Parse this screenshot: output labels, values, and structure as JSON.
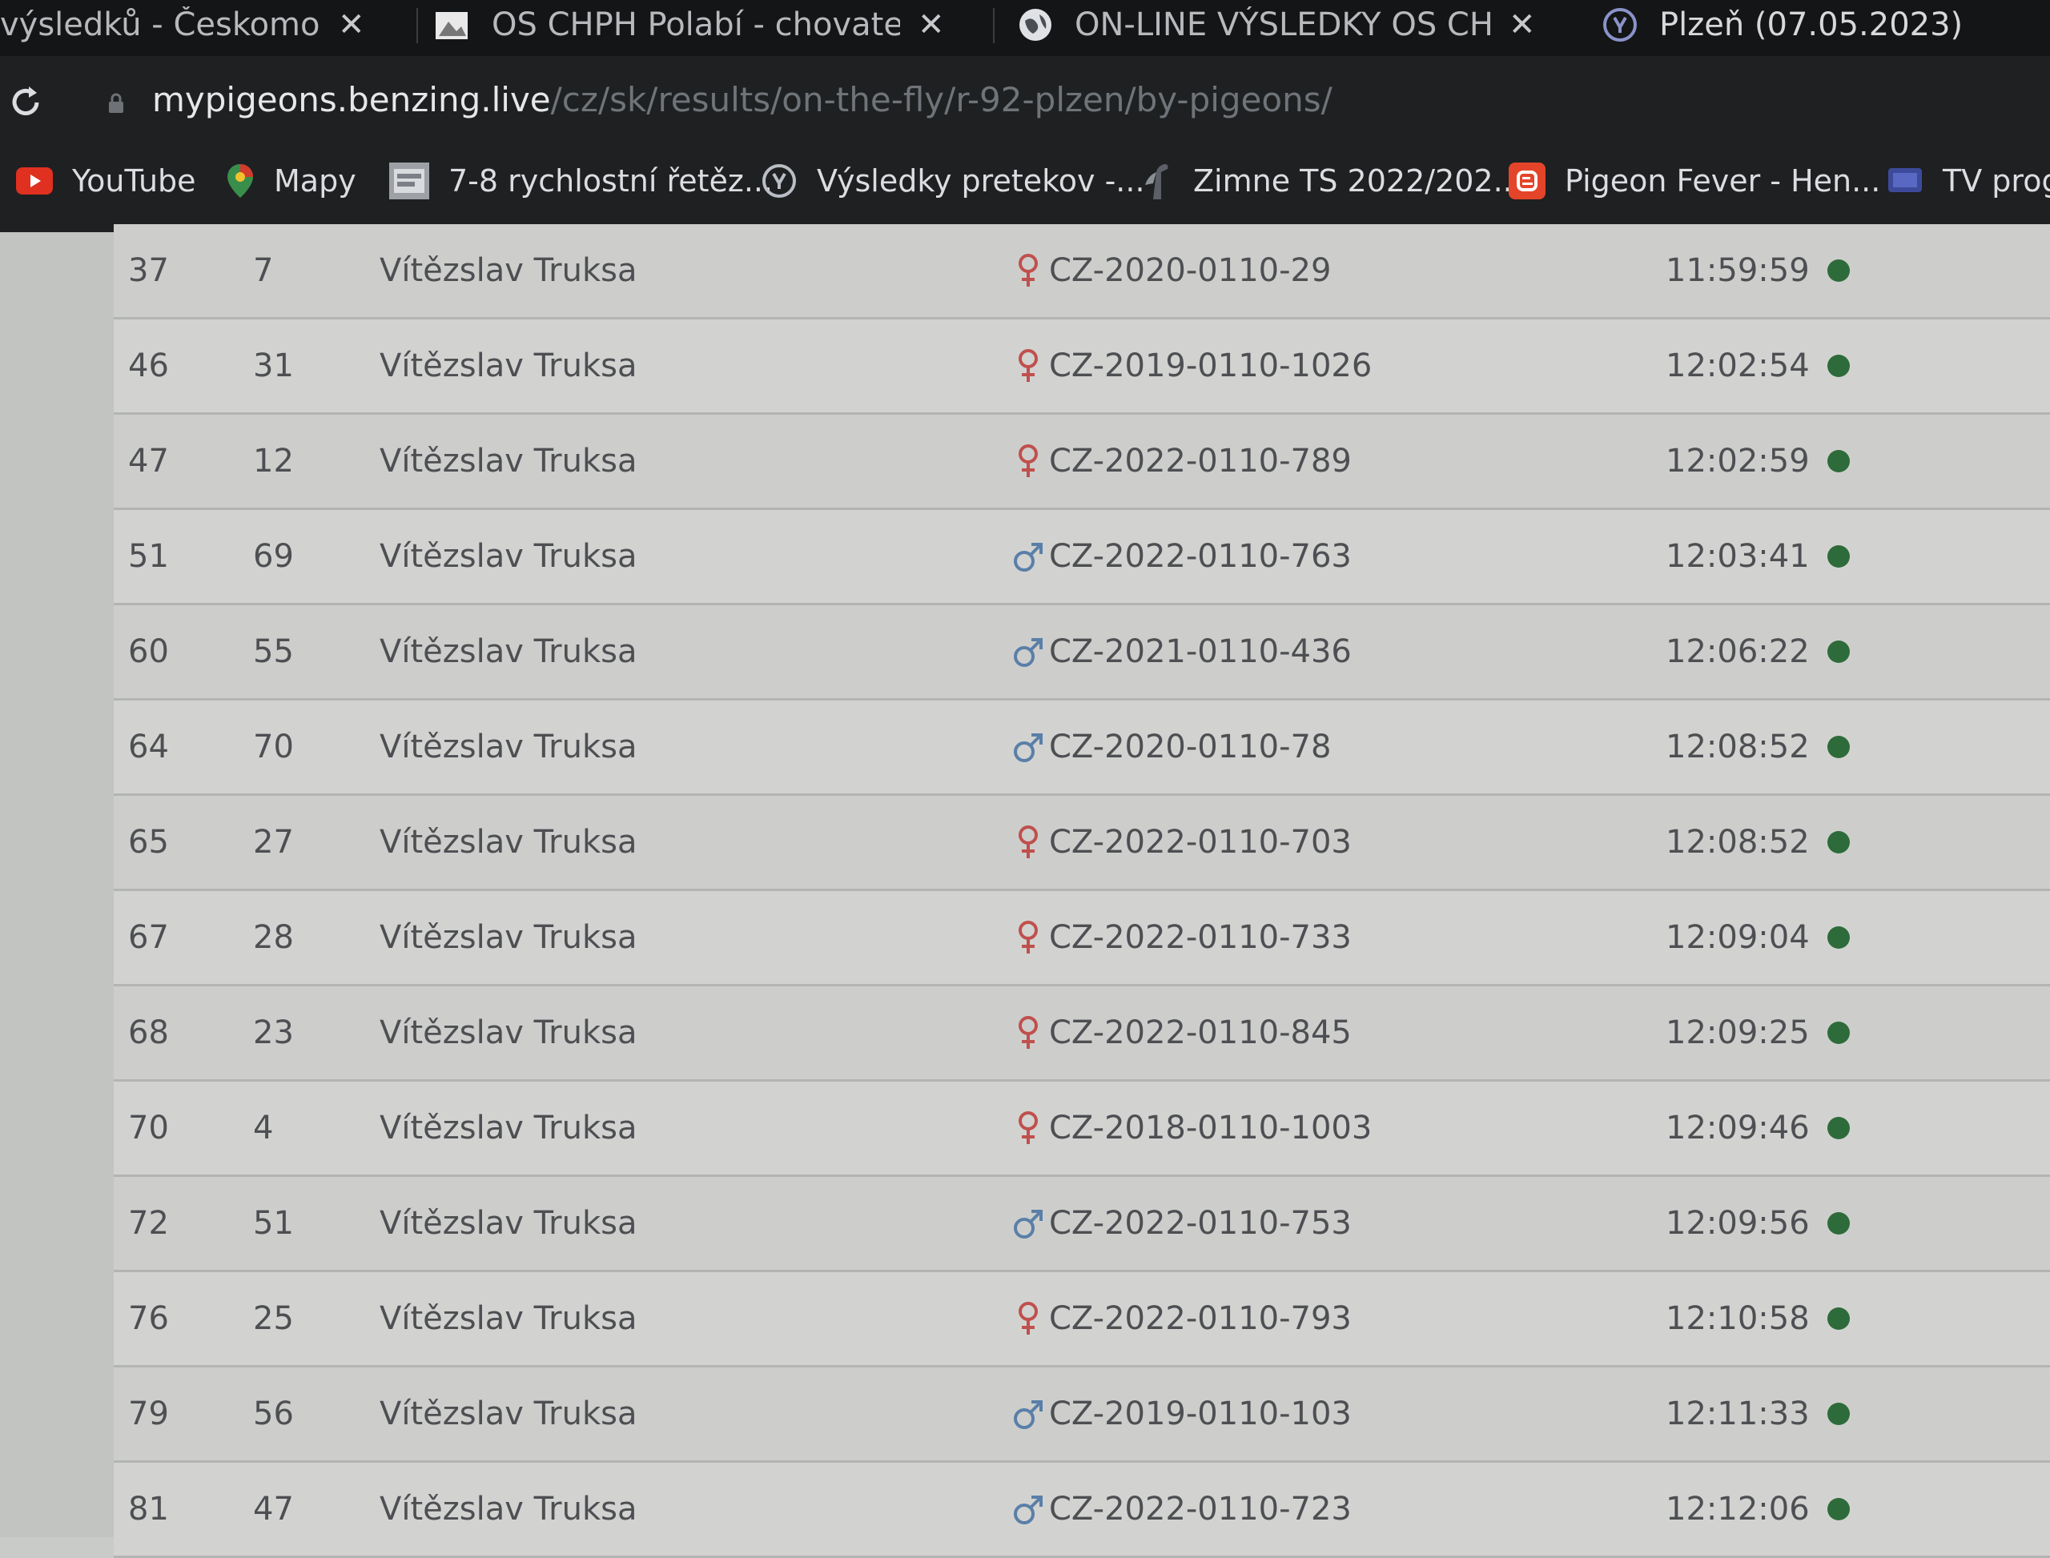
{
  "tabs": [
    {
      "title": "výsledků - Českomoravsk",
      "has_close": true
    },
    {
      "title": "OS CHPH Polabí - chovatelé po",
      "has_close": true,
      "favicon": "site-icon"
    },
    {
      "title": "ON-LINE VÝSLEDKY OS CHPH P",
      "has_close": true,
      "favicon": "globe-icon"
    },
    {
      "title": "Plzeň (07.05.2023)",
      "has_close": false,
      "favicon": "benzing-icon"
    }
  ],
  "address": {
    "host": "mypigeons.benzing.live",
    "path": "/cz/sk/results/on-the-fly/r-92-plzen/by-pigeons/"
  },
  "bookmarks": [
    {
      "label": "YouTube",
      "icon": "youtube-icon"
    },
    {
      "label": "Mapy",
      "icon": "map-pin-icon"
    },
    {
      "label": "7-8 rychlostní řetěz...",
      "icon": "image-icon"
    },
    {
      "label": "Výsledky pretekov -...",
      "icon": "benzing-icon"
    },
    {
      "label": "Zimne TS 2022/202...",
      "icon": "pigeon-icon"
    },
    {
      "label": "Pigeon Fever - Hen...",
      "icon": "blogger-icon"
    },
    {
      "label": "TV prog",
      "icon": "tv-icon"
    }
  ],
  "colors": {
    "female": "#c0504d",
    "male": "#5a7fa8",
    "status": "#2e6b3a"
  },
  "results": [
    {
      "rank": "37",
      "no": "7",
      "name": "Vítězslav Truksa",
      "sex": "female",
      "ring": "CZ-2020-0110-29",
      "time": "11:59:59"
    },
    {
      "rank": "46",
      "no": "31",
      "name": "Vítězslav Truksa",
      "sex": "female",
      "ring": "CZ-2019-0110-1026",
      "time": "12:02:54"
    },
    {
      "rank": "47",
      "no": "12",
      "name": "Vítězslav Truksa",
      "sex": "female",
      "ring": "CZ-2022-0110-789",
      "time": "12:02:59"
    },
    {
      "rank": "51",
      "no": "69",
      "name": "Vítězslav Truksa",
      "sex": "male",
      "ring": "CZ-2022-0110-763",
      "time": "12:03:41"
    },
    {
      "rank": "60",
      "no": "55",
      "name": "Vítězslav Truksa",
      "sex": "male",
      "ring": "CZ-2021-0110-436",
      "time": "12:06:22"
    },
    {
      "rank": "64",
      "no": "70",
      "name": "Vítězslav Truksa",
      "sex": "male",
      "ring": "CZ-2020-0110-78",
      "time": "12:08:52"
    },
    {
      "rank": "65",
      "no": "27",
      "name": "Vítězslav Truksa",
      "sex": "female",
      "ring": "CZ-2022-0110-703",
      "time": "12:08:52"
    },
    {
      "rank": "67",
      "no": "28",
      "name": "Vítězslav Truksa",
      "sex": "female",
      "ring": "CZ-2022-0110-733",
      "time": "12:09:04"
    },
    {
      "rank": "68",
      "no": "23",
      "name": "Vítězslav Truksa",
      "sex": "female",
      "ring": "CZ-2022-0110-845",
      "time": "12:09:25"
    },
    {
      "rank": "70",
      "no": "4",
      "name": "Vítězslav Truksa",
      "sex": "female",
      "ring": "CZ-2018-0110-1003",
      "time": "12:09:46"
    },
    {
      "rank": "72",
      "no": "51",
      "name": "Vítězslav Truksa",
      "sex": "male",
      "ring": "CZ-2022-0110-753",
      "time": "12:09:56"
    },
    {
      "rank": "76",
      "no": "25",
      "name": "Vítězslav Truksa",
      "sex": "female",
      "ring": "CZ-2022-0110-793",
      "time": "12:10:58"
    },
    {
      "rank": "79",
      "no": "56",
      "name": "Vítězslav Truksa",
      "sex": "male",
      "ring": "CZ-2019-0110-103",
      "time": "12:11:33"
    },
    {
      "rank": "81",
      "no": "47",
      "name": "Vítězslav Truksa",
      "sex": "male",
      "ring": "CZ-2022-0110-723",
      "time": "12:12:06"
    }
  ]
}
